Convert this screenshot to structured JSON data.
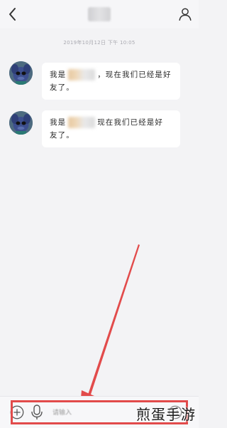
{
  "header": {
    "back_icon": "chevron-left-icon",
    "contact_icon": "person-icon"
  },
  "chat": {
    "timestamp": "2019年10月12日 下午 10:05",
    "messages": [
      {
        "line1_prefix": "我是",
        "line1_suffix": "，现在我们已经是好",
        "line2": "友了。"
      },
      {
        "line1_prefix": "我是",
        "line1_suffix": "现在我们已经是好",
        "line2": "友了。"
      }
    ]
  },
  "input_bar": {
    "placeholder": "请输入",
    "plus_icon": "plus-circle-icon",
    "mic_icon": "microphone-icon",
    "emoji_icon": "emoji-icon"
  },
  "watermark": "煎蛋手游",
  "colors": {
    "annotation": "#e24b4b",
    "background": "#f3f3f5",
    "bubble": "#ffffff"
  }
}
